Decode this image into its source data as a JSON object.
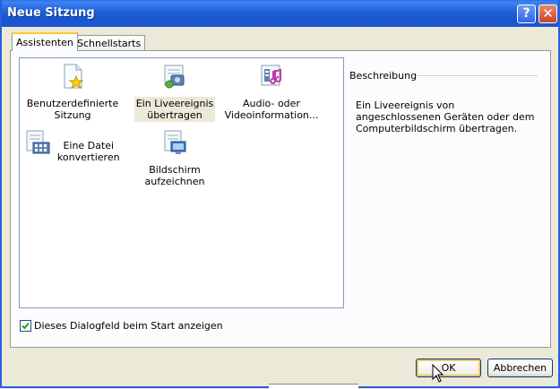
{
  "window": {
    "title": "Neue Sitzung"
  },
  "tabs": [
    {
      "label": "Assistenten",
      "active": true
    },
    {
      "label": "Schnellstarts",
      "active": false
    }
  ],
  "items": [
    {
      "label": "Benutzerdefinierte\nSitzung",
      "icon": "document-star-icon",
      "selected": false
    },
    {
      "label": "Ein Liveereignis\nübertragen",
      "icon": "broadcast-device-icon",
      "selected": true
    },
    {
      "label": "Audio- oder\nVideoinformation...",
      "icon": "media-file-icon",
      "selected": false
    },
    {
      "label": "Eine Datei\nkonvertieren",
      "icon": "convert-file-icon",
      "selected": false
    },
    {
      "label": "Bildschirm aufzeichnen",
      "icon": "screen-capture-icon",
      "selected": false
    }
  ],
  "description": {
    "heading": "Beschreibung",
    "text": "Ein Liveereignis von angeschlossenen Geräten oder dem Computerbildschirm übertragen."
  },
  "startup_checkbox": {
    "label": "Dieses Dialogfeld beim Start anzeigen",
    "checked": true
  },
  "buttons": {
    "ok": "OK",
    "cancel": "Abbrechen"
  },
  "colors": {
    "titlebar": "#1f5fd8",
    "dialog_bg": "#ece9d8",
    "selection_bg": "#ece9d8"
  }
}
